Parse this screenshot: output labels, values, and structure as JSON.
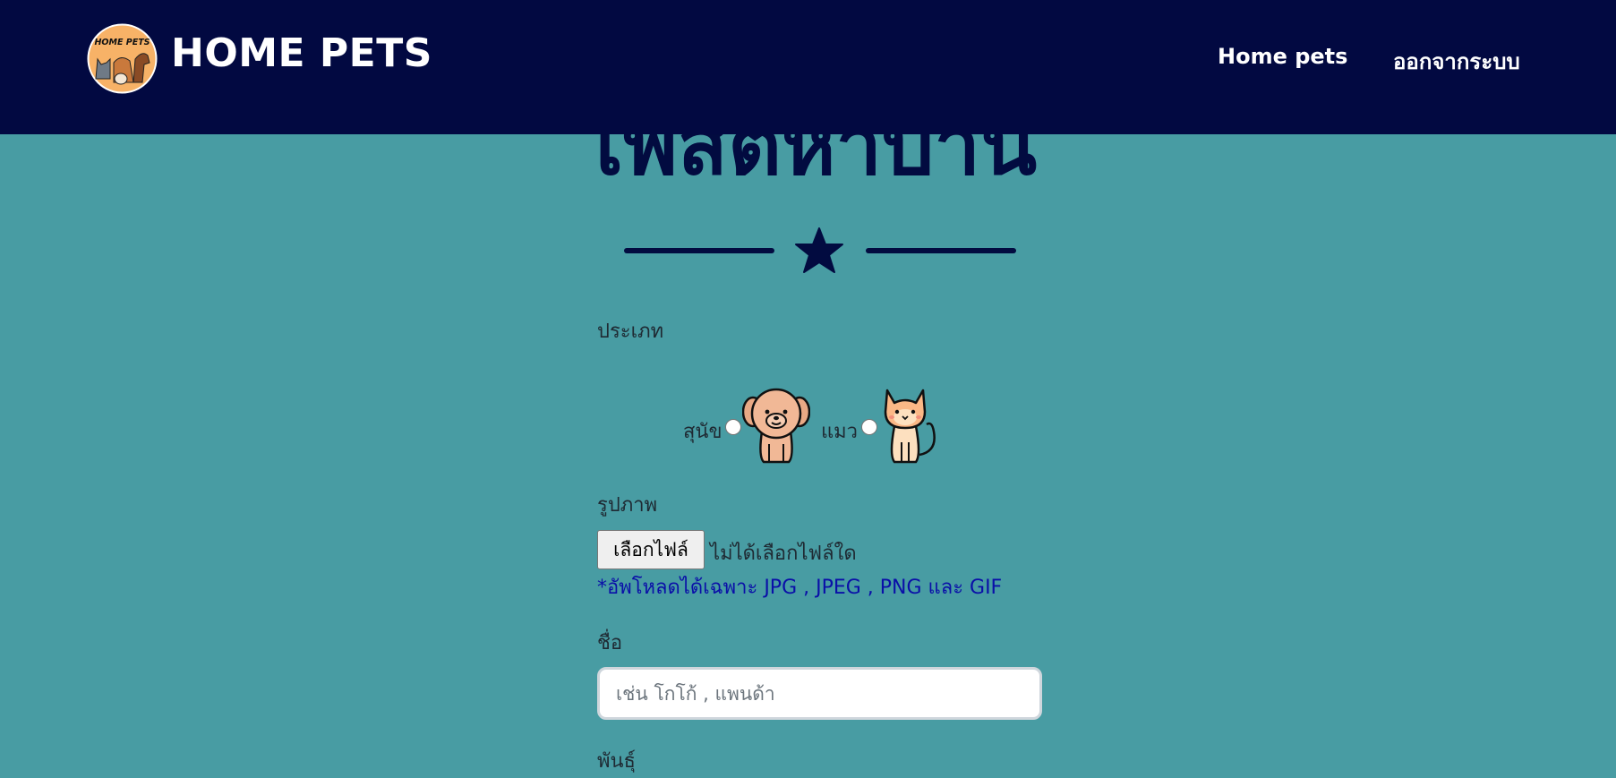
{
  "navbar": {
    "brand": "HOME PETS",
    "logo_text": "HOME PETS",
    "links": [
      {
        "label": "Home pets"
      },
      {
        "label": "ออกจากระบบ"
      }
    ],
    "bg_color": "#020941"
  },
  "page": {
    "title": "โพสต์หาบ้าน",
    "divider_icon": "star-icon",
    "bg_color": "#489ca3"
  },
  "form": {
    "type": {
      "label": "ประเภท",
      "options": [
        {
          "label": "สุนัข",
          "icon": "dog-icon"
        },
        {
          "label": "แมว",
          "icon": "cat-icon"
        }
      ]
    },
    "image": {
      "label": "รูปภาพ",
      "button_label": "เลือกไฟล์",
      "status": "ไม่ได้เลือกไฟล์ใด",
      "hint": "*อัพโหลดได้เฉพาะ JPG , JPEG , PNG และ GIF"
    },
    "name": {
      "label": "ชื่อ",
      "placeholder": "เช่น โกโก้ , แพนด้า",
      "value": ""
    },
    "breed": {
      "label": "พันธุ์"
    }
  }
}
